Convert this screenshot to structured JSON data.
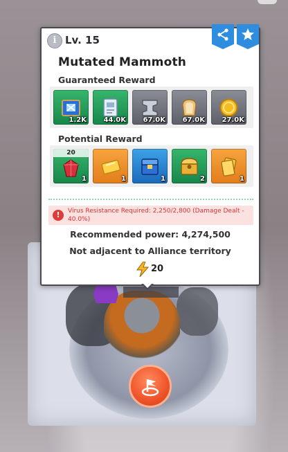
{
  "popup": {
    "level": "Lv. 15",
    "title": "Mutated Mammoth",
    "guaranteed_label": "Guaranteed Reward",
    "potential_label": "Potential Reward",
    "guaranteed_rewards": [
      {
        "icon": "blue-chip-crate-icon",
        "qty": "1.2K",
        "bg": "green"
      },
      {
        "icon": "manual-book-icon",
        "qty": "44.0K",
        "bg": "green"
      },
      {
        "icon": "iron-ingot-icon",
        "qty": "67.0K",
        "bg": "grey"
      },
      {
        "icon": "bread-icon",
        "qty": "67.0K",
        "bg": "grey"
      },
      {
        "icon": "gold-coin-icon",
        "qty": "27.0K",
        "bg": "grey"
      }
    ],
    "potential_rewards": [
      {
        "icon": "red-crystal-icon",
        "level": "20",
        "qty": "1",
        "bg": "green"
      },
      {
        "icon": "gold-ticket-icon",
        "qty": "1",
        "bg": "orange"
      },
      {
        "icon": "blue-chest-icon",
        "qty": "1",
        "bg": "blue"
      },
      {
        "icon": "gold-chest-icon",
        "qty": "2",
        "bg": "green"
      },
      {
        "icon": "gold-card-stack-icon",
        "qty": "1",
        "bg": "orange"
      }
    ],
    "warning": "Virus Resistance Required: 2,250/2,800 (Damage Dealt - 40.0%)",
    "recommended_power": "Recommended power: 4,274,500",
    "territory_note": "Not adjacent to Alliance territory",
    "stamina_cost": "20"
  },
  "colors": {
    "accent_blue": "#2f8ddf",
    "warning_red": "#d83232",
    "march_orange": "#f0532a"
  }
}
